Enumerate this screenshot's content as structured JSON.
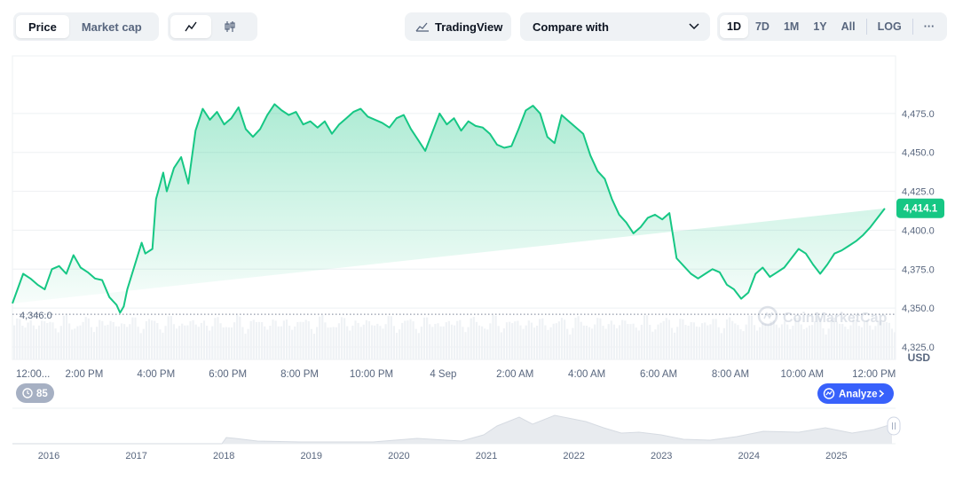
{
  "toolbar": {
    "metric_tabs": [
      {
        "label": "Price",
        "active": true
      },
      {
        "label": "Market cap",
        "active": false
      }
    ],
    "chart_type_icons": [
      "line-chart-icon",
      "candlestick-icon"
    ],
    "tradingview_label": "TradingView",
    "compare_label": "Compare with",
    "ranges": [
      "1D",
      "7D",
      "1M",
      "1Y",
      "All"
    ],
    "active_range": "1D",
    "log_label": "LOG",
    "more_label": "···"
  },
  "colors": {
    "line": "#16c784",
    "area_top": "#16c784",
    "price_tag_bg": "#16c784",
    "analyze_bg": "#3861fb",
    "badge_bg": "#a6b0c3"
  },
  "chart_data": {
    "type": "area",
    "currency_label": "USD",
    "watermark": "CoinMarketCap",
    "current_price_label": "4,414.1",
    "low_label": "4,346.0",
    "y_ticks": [
      "4,475.0",
      "4,450.0",
      "4,425.0",
      "4,400.0",
      "4,375.0",
      "4,350.0",
      "4,325.0"
    ],
    "y_tick_values": [
      4475,
      4450,
      4425,
      4400,
      4375,
      4350,
      4325
    ],
    "ylim": [
      4317,
      4512
    ],
    "low_value": 4346,
    "current_value": 4414.1,
    "x_ticks": [
      "12:00...",
      "2:00 PM",
      "4:00 PM",
      "6:00 PM",
      "8:00 PM",
      "10:00 PM",
      "4 Sep",
      "2:00 AM",
      "4:00 AM",
      "6:00 AM",
      "8:00 AM",
      "10:00 AM",
      "12:00 PM"
    ],
    "x_tick_hours": [
      0.1,
      2,
      4,
      6,
      8,
      10,
      12,
      14,
      16,
      18,
      20,
      22,
      24
    ],
    "xlim_hours": [
      0,
      24.6
    ],
    "series": [
      {
        "x_hours": [
          0,
          0.3,
          0.5,
          0.7,
          0.9,
          1.1,
          1.3,
          1.5,
          1.7,
          1.9,
          2.1,
          2.3,
          2.5,
          2.7,
          2.9,
          3.0,
          3.1,
          3.2,
          3.4,
          3.6,
          3.7,
          3.9,
          4.0,
          4.2,
          4.3,
          4.5,
          4.7,
          4.9,
          5.1,
          5.3,
          5.5,
          5.7,
          5.9,
          6.1,
          6.3,
          6.5,
          6.7,
          6.9,
          7.1,
          7.3,
          7.5,
          7.7,
          7.9,
          8.1,
          8.3,
          8.5,
          8.7,
          8.9,
          9.1,
          9.3,
          9.5,
          9.7,
          9.9,
          10.1,
          10.3,
          10.5,
          10.7,
          10.9,
          11.1,
          11.3,
          11.5,
          11.7,
          11.9,
          12.1,
          12.3,
          12.5,
          12.7,
          12.9,
          13.1,
          13.3,
          13.5,
          13.7,
          13.9,
          14.1,
          14.3,
          14.5,
          14.7,
          14.9,
          15.1,
          15.3,
          15.5,
          15.7,
          15.9,
          16.1,
          16.3,
          16.5,
          16.7,
          16.9,
          17.1,
          17.3,
          17.5,
          17.7,
          17.9,
          18.1,
          18.3,
          18.5,
          18.7,
          18.9,
          19.1,
          19.3,
          19.5,
          19.7,
          19.9,
          20.1,
          20.3,
          20.5,
          20.7,
          20.9,
          21.1,
          21.3,
          21.5,
          21.7,
          21.9,
          22.1,
          22.3,
          22.5,
          22.7,
          22.9,
          23.1,
          23.3,
          23.5,
          23.7,
          23.9,
          24.1,
          24.3,
          24.6
        ],
        "values": [
          4353,
          4372,
          4369,
          4365,
          4362,
          4375,
          4377,
          4372,
          4384,
          4376,
          4373,
          4369,
          4368,
          4357,
          4352,
          4347,
          4351,
          4362,
          4377,
          4392,
          4385,
          4388,
          4420,
          4437,
          4425,
          4440,
          4447,
          4430,
          4464,
          4478,
          4471,
          4476,
          4468,
          4472,
          4479,
          4465,
          4460,
          4465,
          4474,
          4481,
          4477,
          4474,
          4476,
          4468,
          4470,
          4466,
          4470,
          4462,
          4468,
          4472,
          4476,
          4478,
          4473,
          4471,
          4469,
          4466,
          4472,
          4474,
          4465,
          4458,
          4451,
          4463,
          4475,
          4468,
          4472,
          4464,
          4470,
          4467,
          4466,
          4462,
          4455,
          4453,
          4454,
          4465,
          4477,
          4480,
          4475,
          4460,
          4456,
          4474,
          4470,
          4466,
          4462,
          4448,
          4438,
          4433,
          4420,
          4410,
          4405,
          4398,
          4402,
          4408,
          4410,
          4407,
          4411,
          4382,
          4377,
          4372,
          4369,
          4372,
          4375,
          4373,
          4365,
          4362,
          4356,
          4360,
          4372,
          4376,
          4370,
          4373,
          4376,
          4382,
          4388,
          4385,
          4378,
          4372,
          4378,
          4385,
          4387,
          4390,
          4393,
          4397,
          4402,
          4408,
          4414
        ]
      }
    ],
    "overview": {
      "x_ticks": [
        "2016",
        "2017",
        "2018",
        "2019",
        "2020",
        "2021",
        "2022",
        "2023",
        "2024",
        "2025"
      ]
    }
  },
  "badges": {
    "timer_value": "85",
    "analyze_label": "Analyze"
  }
}
